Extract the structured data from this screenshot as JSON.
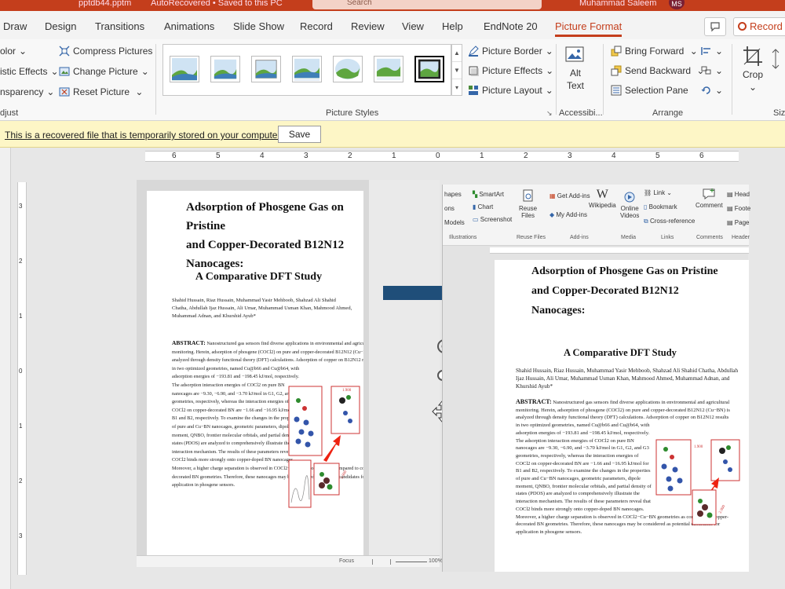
{
  "titlebar": {
    "filename": "pptdb44.pptm",
    "autosave": "AutoRecovered • Saved to this PC",
    "search_placeholder": "Search",
    "user": "Muhammad Saleem",
    "initials": "MS"
  },
  "tabs": [
    "Draw",
    "Design",
    "Transitions",
    "Animations",
    "Slide Show",
    "Record",
    "Review",
    "View",
    "Help",
    "EndNote 20",
    "Picture Format"
  ],
  "active_tab": "Picture Format",
  "record_label": "Record",
  "ribbon": {
    "adjust": {
      "color": "olor",
      "artistic": "istic Effects",
      "transparency": "nsparency",
      "compress": "Compress Pictures",
      "change": "Change Picture",
      "reset": "Reset Picture",
      "label": "djust"
    },
    "styles": {
      "border": "Picture Border",
      "effects": "Picture Effects",
      "layout": "Picture Layout",
      "label": "Picture Styles"
    },
    "accessibility": {
      "alt_line1": "Alt",
      "alt_line2": "Text",
      "label": "Accessibi..."
    },
    "arrange": {
      "bring_forward": "Bring Forward",
      "send_backward": "Send Backward",
      "selection_pane": "Selection Pane",
      "label": "Arrange"
    },
    "size": {
      "crop": "Crop",
      "label": "Siz"
    }
  },
  "infobar": {
    "message": "This is a recovered file that is temporarily stored on your computer.",
    "save_label": "Save"
  },
  "hruler": [
    "6",
    "5",
    "4",
    "3",
    "2",
    "1",
    "0",
    "1",
    "2",
    "3",
    "4",
    "5",
    "6"
  ],
  "vruler": [
    "3",
    "2",
    "1",
    "0",
    "1",
    "2",
    "3"
  ],
  "paper": {
    "title_line1": "Adsorption of Phosgene Gas on Pristine",
    "title_line2": "and Copper-Decorated B12N12",
    "title_line3": "Nanocages:",
    "subtitle": "A Comparative DFT Study",
    "authors": "Shahid Hussain, Riaz Hussain, Muhammad Yasir Mehboob, Shahzad Ali Shahid Chatha, Abdullah Ijaz Hussain, Ali Umar, Muhammad Usman Khan, Mahmood Ahmed, Muhammad Adnan, and Khurshid Ayub*",
    "abstract_head": "ABSTRACT:",
    "abstract_lines": [
      "Nanostructured gas sensors find diverse applications in environmental and agricultural",
      "monitoring. Herein, adsorption of phosgene (COCl2) on pure and copper-decorated B12N12 (Cu−BN) is",
      "analyzed through density functional theory (DFT) calculations. Adsorption of copper on B12N12 results",
      "in two optimized geometries, named Cu@b66 and Cu@b64, with",
      "adsorption energies of −193.81 and −198.45 kJ/mol, respectively.",
      "The adsorption interaction energies of COCl2 on pure BN",
      "nanocages are −9.30, −6.90, and −3.70 kJ/mol in G1, G2, and G3",
      "geometries, respectively, whereas the interaction energies of",
      "COCl2 on copper-decorated BN are −1.66 and −16.95 kJ/mol for",
      "B1 and B2, respectively. To examine the changes in the properties",
      "of pure and Cu−BN nanocages, geometric parameters, dipole",
      "moment, QNBO, frontier molecular orbitals, and partial density of",
      "states (PDOS) are analyzed to comprehensively illustrate the",
      "interaction mechanism. The results of these parameters reveal that",
      "COCl2 binds more strongly onto copper-doped BN nanocages.",
      "Moreover, a higher charge separation is observed in COCl2−Cu−BN geometries as compared to copper-",
      "decorated BN geometries. Therefore, these nanocages may be considered as potential candidates for",
      "application in phosgene sensors."
    ],
    "fig_label_a": "1.900",
    "fig_label_b": "2.000"
  },
  "word_ribbon": {
    "shapes": "hapes",
    "smartart": "SmartArt",
    "chart": "Chart",
    "screenshot": "Screenshot",
    "models": "Models",
    "icons": "ons",
    "reuse_line1": "Reuse",
    "reuse_line2": "Files",
    "get_addins": "Get Add-ins",
    "my_addins": "My Add-ins",
    "wikipedia": "Wikipedia",
    "online_line1": "Online",
    "online_line2": "Videos",
    "link": "Link",
    "bookmark": "Bookmark",
    "crossref": "Cross-reference",
    "comment": "Comment",
    "header": "Head",
    "footer": "Foote",
    "page": "Page",
    "groups": [
      "Illustrations",
      "Reuse Files",
      "Add-ins",
      "Media",
      "Links",
      "Comments",
      "Header"
    ]
  },
  "status_left": {
    "focus": "Focus",
    "zoom": "100%"
  }
}
